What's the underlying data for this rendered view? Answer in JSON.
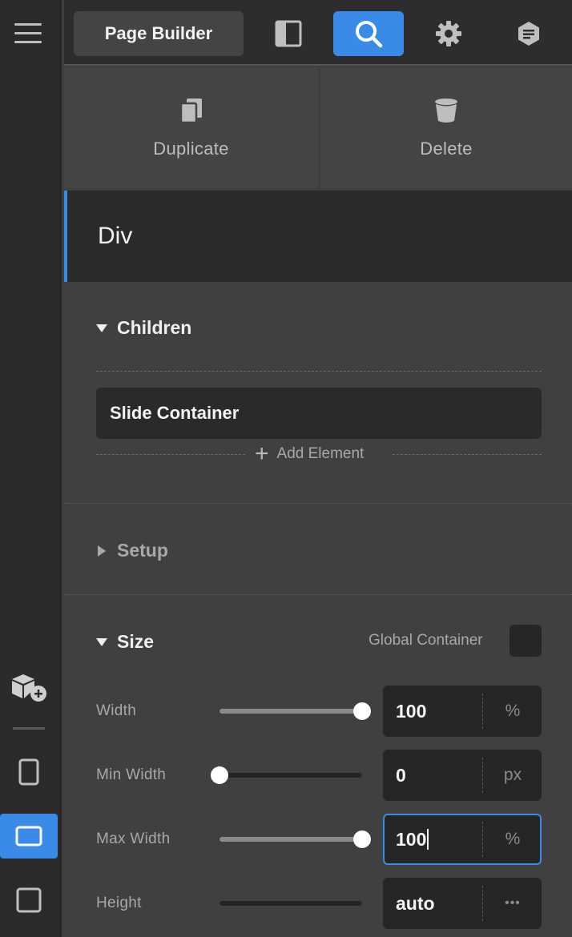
{
  "topbar": {
    "title": "Page Builder",
    "icons": [
      "sidebar-toggle-icon",
      "search-icon",
      "gear-icon",
      "notes-icon"
    ]
  },
  "actions": {
    "duplicate_label": "Duplicate",
    "delete_label": "Delete"
  },
  "element": {
    "type_label": "Div"
  },
  "children": {
    "title": "Children",
    "items": [
      "Slide Container"
    ],
    "add_label": "Add Element"
  },
  "setup": {
    "title": "Setup"
  },
  "size": {
    "title": "Size",
    "global_container_label": "Global Container",
    "rows": [
      {
        "label": "Width",
        "value": "100",
        "unit": "%",
        "slider_fraction": 1.0
      },
      {
        "label": "Min Width",
        "value": "0",
        "unit": "px",
        "slider_fraction": 0.0
      },
      {
        "label": "Max Width",
        "value": "100",
        "unit": "%",
        "slider_fraction": 1.0
      },
      {
        "label": "Height",
        "value": "auto",
        "unit": "•••",
        "slider_fraction": 0.0
      }
    ]
  },
  "colors": {
    "accent": "#3a8be8",
    "rail_bg": "#2b2b2b",
    "panel_bg": "#404040"
  }
}
